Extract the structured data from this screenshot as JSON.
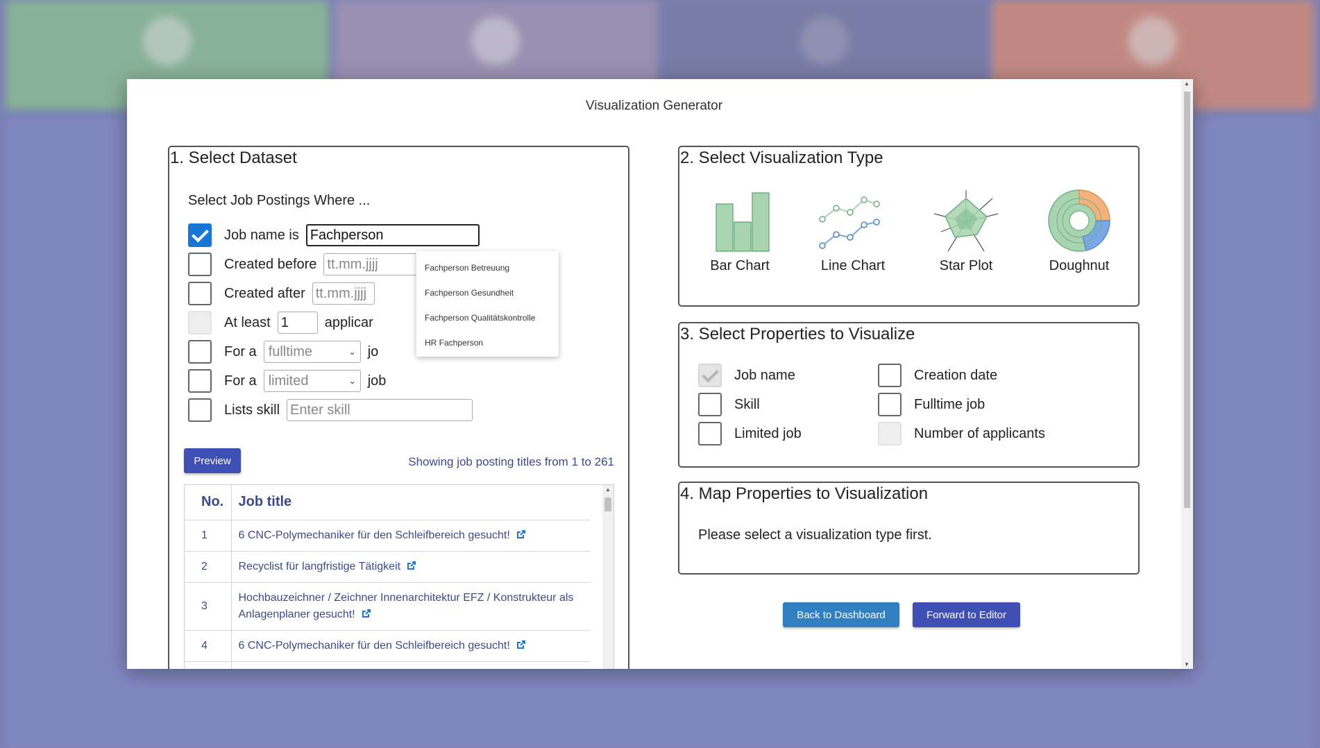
{
  "modal": {
    "title": "Visualization Generator"
  },
  "dataset": {
    "title": "1. Select Dataset",
    "subtitle": "Select Job Postings Where ...",
    "job_name_label": "Job name is",
    "job_name_value": "Fachperson",
    "created_before_label": "Created before",
    "created_before_placeholder": "tt.mm.jjjj",
    "created_after_label": "Created after",
    "created_after_placeholder": "tt.mm.jjjj",
    "at_least_label": "At least",
    "at_least_value": "1",
    "applicants_label": "applicar",
    "for_a_label_1": "For a",
    "fulltime_value": "fulltime",
    "job_suffix_1": "jo",
    "for_a_label_2": "For a",
    "limited_value": "limited",
    "job_suffix_2": "job",
    "lists_skill_label": "Lists skill",
    "skill_placeholder": "Enter skill",
    "suggestions": [
      "Fachperson Betreuung",
      "Fachperson Gesundheit",
      "Fachperson Qualitätskontrolle",
      "HR Fachperson"
    ],
    "preview_label": "Preview",
    "showing_text": "Showing job posting titles from 1 to 261",
    "table": {
      "headers": [
        "No.",
        "Job title"
      ],
      "rows": [
        {
          "no": "1",
          "title": "6 CNC-Polymechaniker für den Schleifbereich gesucht!"
        },
        {
          "no": "2",
          "title": "Recyclist für langfristige Tätigkeit"
        },
        {
          "no": "3",
          "title": "Hochbauzeichner / Zeichner Innenarchitektur EFZ / Konstrukteur als Anlagenplaner gesucht!"
        },
        {
          "no": "4",
          "title": "6 CNC-Polymechaniker für den Schleifbereich gesucht!"
        }
      ]
    }
  },
  "viz_type": {
    "title": "2. Select Visualization Type",
    "options": [
      "Bar Chart",
      "Line Chart",
      "Star Plot",
      "Doughnut"
    ]
  },
  "properties": {
    "title": "3. Select Properties to Visualize",
    "items": [
      "Job name",
      "Creation date",
      "Skill",
      "Fulltime job",
      "Limited job",
      "Number of applicants"
    ]
  },
  "mapping": {
    "title": "4. Map Properties to Visualization",
    "message": "Please select a visualization type first."
  },
  "footer": {
    "back_label": "Back to Dashboard",
    "forward_label": "Forward to Editor"
  },
  "colors": {
    "accent": "#3f4fb5",
    "checkbox": "#1976d2",
    "chart_green": "#a8d5b0",
    "chart_orange": "#f5b27d",
    "chart_blue": "#7aa7e6"
  }
}
